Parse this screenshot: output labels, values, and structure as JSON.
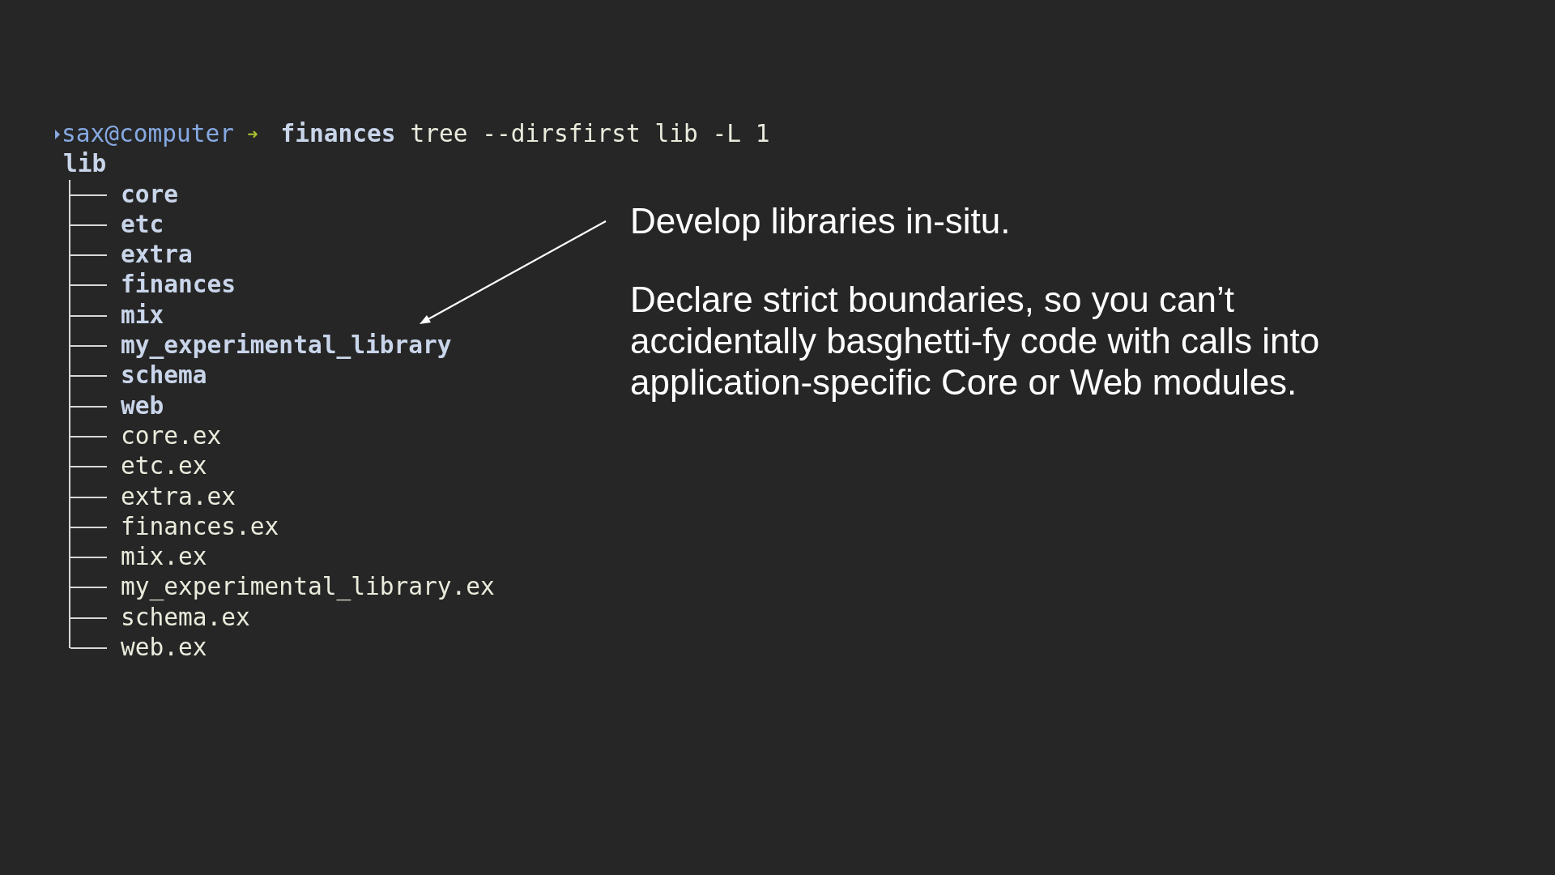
{
  "terminal": {
    "prompt": {
      "user_host": "sax@computer",
      "arrow": "➜",
      "directory": "finances",
      "command": "tree --dirsfirst lib -L 1"
    },
    "root": "lib",
    "children": [
      {
        "name": "core",
        "kind": "dir"
      },
      {
        "name": "etc",
        "kind": "dir"
      },
      {
        "name": "extra",
        "kind": "dir"
      },
      {
        "name": "finances",
        "kind": "dir"
      },
      {
        "name": "mix",
        "kind": "dir"
      },
      {
        "name": "my_experimental_library",
        "kind": "dir"
      },
      {
        "name": "schema",
        "kind": "dir"
      },
      {
        "name": "web",
        "kind": "dir"
      },
      {
        "name": "core.ex",
        "kind": "file"
      },
      {
        "name": "etc.ex",
        "kind": "file"
      },
      {
        "name": "extra.ex",
        "kind": "file"
      },
      {
        "name": "finances.ex",
        "kind": "file"
      },
      {
        "name": "mix.ex",
        "kind": "file"
      },
      {
        "name": "my_experimental_library.ex",
        "kind": "file"
      },
      {
        "name": "schema.ex",
        "kind": "file"
      },
      {
        "name": "web.ex",
        "kind": "file"
      }
    ]
  },
  "notes": [
    "Develop libraries in-situ.",
    "Declare strict boundaries, so you can’t accidentally basghetti-fy code with calls into application-specific Core or Web modules."
  ]
}
